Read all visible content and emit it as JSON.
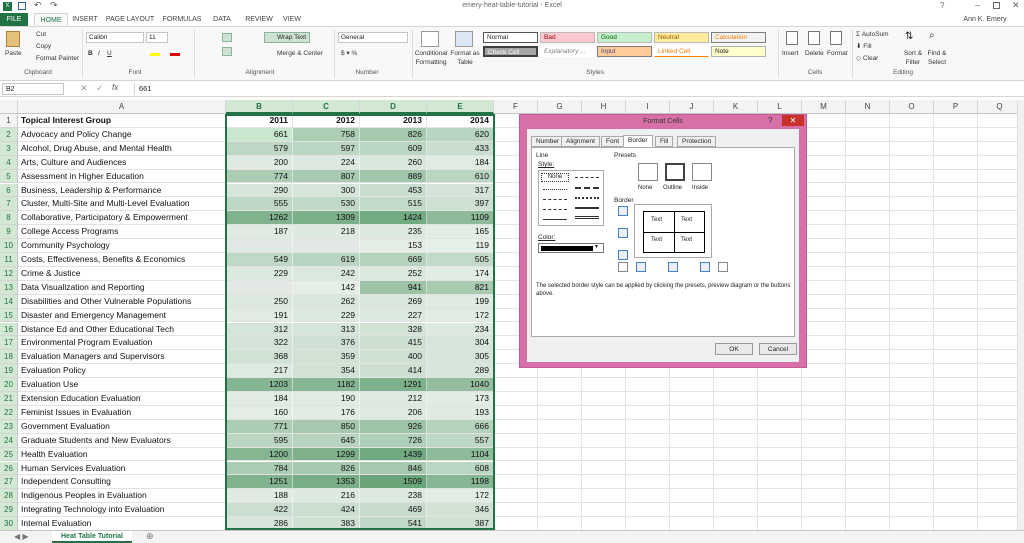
{
  "window": {
    "title": "emery-heat-table-tutorial - Excel",
    "user": "Ann K. Emery"
  },
  "ribbon_tabs": [
    "FILE",
    "HOME",
    "INSERT",
    "PAGE LAYOUT",
    "FORMULAS",
    "DATA",
    "REVIEW",
    "VIEW"
  ],
  "ribbon": {
    "clipboard": {
      "paste": "Paste",
      "cut": "Cut",
      "copy": "Copy",
      "format_painter": "Format Painter",
      "label": "Clipboard"
    },
    "font": {
      "name": "Calibri",
      "size": "11",
      "label": "Font"
    },
    "alignment": {
      "wrap": "Wrap Text",
      "merge": "Merge & Center",
      "label": "Alignment"
    },
    "number": {
      "format": "General",
      "label": "Number"
    },
    "styles": {
      "conditional": "Conditional Formatting",
      "format_table": "Format as Table",
      "normal": "Normal",
      "bad": "Bad",
      "good": "Good",
      "neutral": "Neutral",
      "calculation": "Calculation",
      "check_cell": "Check Cell",
      "explanatory": "Explanatory ...",
      "input": "Input",
      "linked": "Linked Cell",
      "note": "Note",
      "label": "Styles"
    },
    "cells": {
      "insert": "Insert",
      "delete": "Delete",
      "format": "Format",
      "label": "Cells"
    },
    "editing": {
      "autosum": "AutoSum",
      "fill": "Fill",
      "clear": "Clear",
      "sort": "Sort & Filter",
      "find": "Find & Select",
      "label": "Editing"
    }
  },
  "formula_bar": {
    "name_box": "B2",
    "fx": "fx",
    "value": "661"
  },
  "columns": [
    "A",
    "B",
    "C",
    "D",
    "E",
    "F",
    "G",
    "H",
    "I",
    "J",
    "K",
    "L",
    "M",
    "N",
    "O",
    "P",
    "Q"
  ],
  "header_row": {
    "label": "Topical Interest Group",
    "years": [
      "2011",
      "2012",
      "2013",
      "2014"
    ]
  },
  "rows": [
    {
      "n": "2",
      "label": "Advocacy and Policy Change",
      "v": [
        "661",
        "758",
        "826",
        "620"
      ]
    },
    {
      "n": "3",
      "label": "Alcohol, Drug Abuse, and Mental Health",
      "v": [
        "579",
        "597",
        "609",
        "433"
      ]
    },
    {
      "n": "4",
      "label": "Arts, Culture and Audiences",
      "v": [
        "200",
        "224",
        "260",
        "184"
      ]
    },
    {
      "n": "5",
      "label": "Assessment in Higher Education",
      "v": [
        "774",
        "807",
        "889",
        "610"
      ]
    },
    {
      "n": "6",
      "label": "Business, Leadership & Performance",
      "v": [
        "290",
        "300",
        "453",
        "317"
      ]
    },
    {
      "n": "7",
      "label": "Cluster, Multi-Site and Multi-Level Evaluation",
      "v": [
        "555",
        "530",
        "515",
        "397"
      ]
    },
    {
      "n": "8",
      "label": "Collaborative, Participatory & Empowerment",
      "v": [
        "1262",
        "1309",
        "1424",
        "1109"
      ]
    },
    {
      "n": "9",
      "label": "College Access Programs",
      "v": [
        "187",
        "218",
        "235",
        "165"
      ]
    },
    {
      "n": "10",
      "label": "Community Psychology",
      "v": [
        "",
        "",
        "153",
        "119"
      ]
    },
    {
      "n": "11",
      "label": "Costs, Effectiveness, Benefits & Economics",
      "v": [
        "549",
        "619",
        "669",
        "505"
      ]
    },
    {
      "n": "12",
      "label": "Crime & Justice",
      "v": [
        "229",
        "242",
        "252",
        "174"
      ]
    },
    {
      "n": "13",
      "label": "Data Visualization and Reporting",
      "v": [
        "",
        "142",
        "941",
        "821"
      ]
    },
    {
      "n": "14",
      "label": "Disabilities and Other Vulnerable Populations",
      "v": [
        "250",
        "262",
        "269",
        "199"
      ]
    },
    {
      "n": "15",
      "label": "Disaster and Emergency Management",
      "v": [
        "191",
        "229",
        "227",
        "172"
      ]
    },
    {
      "n": "16",
      "label": "Distance Ed and Other Educational Tech",
      "v": [
        "312",
        "313",
        "328",
        "234"
      ]
    },
    {
      "n": "17",
      "label": "Environmental Program Evaluation",
      "v": [
        "322",
        "376",
        "415",
        "304"
      ]
    },
    {
      "n": "18",
      "label": "Evaluation Managers and Supervisors",
      "v": [
        "368",
        "359",
        "400",
        "305"
      ]
    },
    {
      "n": "19",
      "label": "Evaluation Policy",
      "v": [
        "217",
        "354",
        "414",
        "289"
      ]
    },
    {
      "n": "20",
      "label": "Evaluation Use",
      "v": [
        "1203",
        "1182",
        "1291",
        "1040"
      ]
    },
    {
      "n": "21",
      "label": "Extension Education Evaluation",
      "v": [
        "184",
        "190",
        "212",
        "173"
      ]
    },
    {
      "n": "22",
      "label": "Feminist Issues in Evaluation",
      "v": [
        "160",
        "176",
        "206",
        "193"
      ]
    },
    {
      "n": "23",
      "label": "Government Evaluation",
      "v": [
        "771",
        "850",
        "926",
        "666"
      ]
    },
    {
      "n": "24",
      "label": "Graduate Students and New Evaluators",
      "v": [
        "595",
        "645",
        "726",
        "557"
      ]
    },
    {
      "n": "25",
      "label": "Health Evaluation",
      "v": [
        "1200",
        "1299",
        "1439",
        "1104"
      ]
    },
    {
      "n": "26",
      "label": "Human Services Evaluation",
      "v": [
        "784",
        "826",
        "846",
        "608"
      ]
    },
    {
      "n": "27",
      "label": "Independent Consulting",
      "v": [
        "1251",
        "1353",
        "1509",
        "1198"
      ]
    },
    {
      "n": "28",
      "label": "Indigenous Peoples in Evaluation",
      "v": [
        "188",
        "216",
        "238",
        "172"
      ]
    },
    {
      "n": "29",
      "label": "Integrating Technology into Evaluation",
      "v": [
        "422",
        "424",
        "469",
        "346"
      ]
    },
    {
      "n": "30",
      "label": "Internal Evaluation",
      "v": [
        "286",
        "383",
        "541",
        "387"
      ]
    }
  ],
  "sheet_tab": "Heat Table Tutorial",
  "dialog": {
    "title": "Format Cells",
    "tabs": [
      "Number",
      "Alignment",
      "Font",
      "Border",
      "Fill",
      "Protection"
    ],
    "line": "Line",
    "style": "Style:",
    "none": "None",
    "color": "Color:",
    "presets": "Presets",
    "preset_none": "None",
    "preset_outline": "Outline",
    "preset_inside": "Inside",
    "border": "Border",
    "text": "Text",
    "help": "The selected border style can be applied by clicking the presets, preview diagram or the buttons above.",
    "ok": "OK",
    "cancel": "Cancel"
  },
  "colors": {
    "accent": "#217346",
    "heat_low": "#e6efe8",
    "heat_high": "#6aa57a",
    "dialog_border": "#d870a8"
  }
}
